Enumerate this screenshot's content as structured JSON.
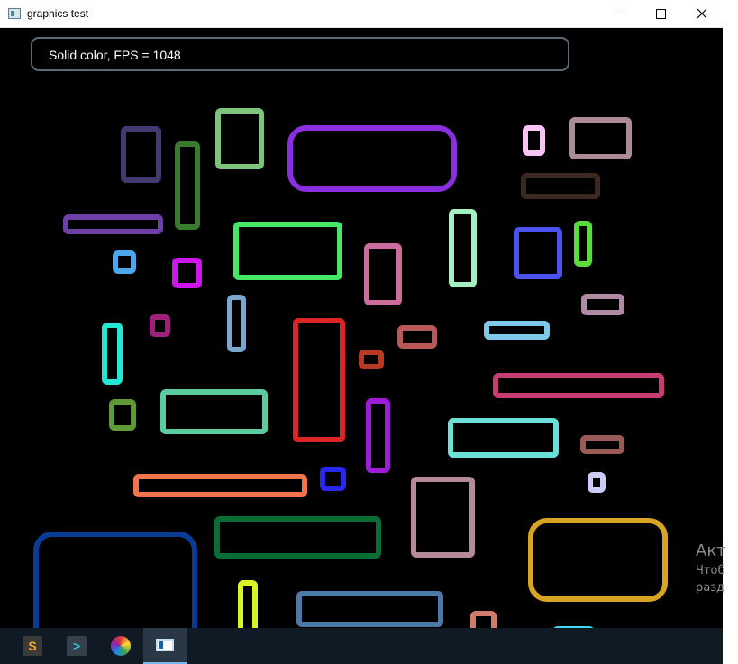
{
  "window": {
    "title": "graphics test",
    "controls": {
      "minimize": "minimize-icon",
      "maximize": "maximize-icon",
      "close": "close-icon"
    }
  },
  "overlay": {
    "text": "Solid color, FPS = 1048"
  },
  "canvas": {
    "background": "#000000",
    "shapes": [
      {
        "c": "#433a72",
        "r": 0
      },
      {
        "c": "#7ec47c",
        "r": 0
      },
      {
        "c": "#8a2ee0",
        "r": 1
      },
      {
        "c": "#f7c4f5",
        "r": 0
      },
      {
        "c": "#ad8a98",
        "r": 0
      },
      {
        "c": "#3a7a2e",
        "r": 0
      },
      {
        "c": "#3c2822",
        "r": 0
      },
      {
        "c": "#6e3fa8",
        "r": 0
      },
      {
        "c": "#a3f0c0",
        "r": 0
      },
      {
        "c": "#44e864",
        "r": 0
      },
      {
        "c": "#cc6c9c",
        "r": 0
      },
      {
        "c": "#4b52f0",
        "r": 0
      },
      {
        "c": "#5bdc3c",
        "r": 0
      },
      {
        "c": "#4ea6ea",
        "r": 0
      },
      {
        "c": "#cc16ec",
        "r": 0
      },
      {
        "c": "#7aa6d0",
        "r": 0
      },
      {
        "c": "#b08aa4",
        "r": 0
      },
      {
        "c": "#24e8d4",
        "r": 0
      },
      {
        "c": "#a01e7c",
        "r": 0
      },
      {
        "c": "#dc2424",
        "r": 0
      },
      {
        "c": "#b85858",
        "r": 0
      },
      {
        "c": "#7ec8e8",
        "r": 0
      },
      {
        "c": "#b83a24",
        "r": 0
      },
      {
        "c": "#c83c74",
        "r": 0
      },
      {
        "c": "#5ccca0",
        "r": 0
      },
      {
        "c": "#5e9a36",
        "r": 0
      },
      {
        "c": "#9c1cd8",
        "r": 0
      },
      {
        "c": "#6ae0d8",
        "r": 0
      },
      {
        "c": "#9a5a56",
        "r": 0
      },
      {
        "c": "#f0744c",
        "r": 0
      },
      {
        "c": "#2828f0",
        "r": 0
      },
      {
        "c": "#ccccf8",
        "r": 0
      },
      {
        "c": "#b48a96",
        "r": 0
      },
      {
        "c": "#0a6e34",
        "r": 0
      },
      {
        "c": "#d8a424",
        "r": 1
      },
      {
        "c": "#0a3c96",
        "r": 1
      },
      {
        "c": "#d8f424",
        "r": 0
      },
      {
        "c": "#4c7aa8",
        "r": 0
      },
      {
        "c": "#d07c68",
        "r": 0
      },
      {
        "c": "#3ed8f0",
        "r": 0
      }
    ]
  },
  "activation": {
    "title": "Акт",
    "line1": "Чтоб",
    "line2": "разд"
  },
  "taskbar": {
    "items": [
      {
        "icon": "sublime-text-icon",
        "glyph": "S"
      },
      {
        "icon": "terminal-icon",
        "glyph": ">"
      },
      {
        "icon": "paint-icon",
        "glyph": ""
      },
      {
        "icon": "graphics-test-window-icon",
        "glyph": ""
      }
    ]
  }
}
